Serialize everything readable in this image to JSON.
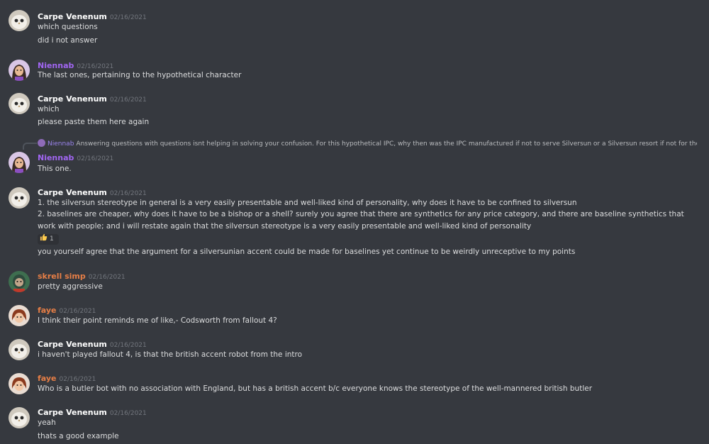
{
  "messages": [
    {
      "author": "Carpe Venenum",
      "timestamp": "02/16/2021",
      "color": "#ffffff",
      "lines": [
        "which questions",
        "did i not answer"
      ]
    },
    {
      "author": "Niennab",
      "timestamp": "02/16/2021",
      "color": "#a166f2",
      "lines": [
        "The last ones, pertaining to the hypothetical character"
      ]
    },
    {
      "author": "Carpe Venenum",
      "timestamp": "02/16/2021",
      "color": "#ffffff",
      "lines": [
        "which",
        "please paste them here again"
      ]
    },
    {
      "author": "Niennab",
      "timestamp": "02/16/2021",
      "color": "#a166f2",
      "reply": {
        "author": "Niennab",
        "text": "Answering questions with questions isnt helping in solving your confusion. For this hypothetical IPC, why then was the IPC manufactured if not to serve Silversun or a Silversun resort if not for the pur..."
      },
      "lines": [
        "This one."
      ]
    },
    {
      "author": "Carpe Venenum",
      "timestamp": "02/16/2021",
      "color": "#ffffff",
      "lines": [
        "1. the silversun stereotype in general is a very easily presentable and well-liked kind of personality, why does it have to be confined to silversun",
        "2. baselines are cheaper, why does it have to be a bishop or a shell? surely you agree that there are synthetics for any price category, and there are baseline synthetics that work with people; and i will restate again that the silversun stereotype is a very easily presentable and well-liked kind of personality",
        "you yourself agree that the argument for a silversunian accent could be made for baselines yet continue to be weirdly unreceptive to my points"
      ],
      "reaction": {
        "icon": "thumbs-up",
        "count": "1"
      }
    },
    {
      "author": "skrell simp",
      "timestamp": "02/16/2021",
      "color": "#e67e46",
      "lines": [
        "pretty aggressive"
      ]
    },
    {
      "author": "faye",
      "timestamp": "02/16/2021",
      "color": "#e67e46",
      "lines": [
        "I think their point reminds me of like,- Codsworth from fallout 4?"
      ]
    },
    {
      "author": "Carpe Venenum",
      "timestamp": "02/16/2021",
      "color": "#ffffff",
      "lines": [
        "i haven't played fallout 4, is that the british accent robot from the intro"
      ]
    },
    {
      "author": "faye",
      "timestamp": "02/16/2021",
      "color": "#e67e46",
      "lines": [
        "Who is a butler bot with no association with England, but has a british accent b/c everyone knows the stereotype of the well-mannered british butler"
      ]
    },
    {
      "author": "Carpe Venenum",
      "timestamp": "02/16/2021",
      "color": "#ffffff",
      "lines": [
        "yeah",
        "thats a good example"
      ]
    }
  ],
  "colors": {
    "background": "#36393f",
    "text": "#dcddde",
    "timestamp": "#72767d",
    "reply_name": "#9b84ee"
  }
}
